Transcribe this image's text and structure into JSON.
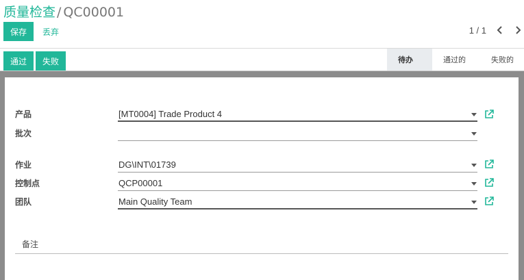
{
  "breadcrumb": {
    "root": "质量检查",
    "separator": "/",
    "current": "QC00001"
  },
  "toolbar": {
    "save_label": "保存",
    "discard_label": "丢弃"
  },
  "pager": {
    "value": "1 / 1"
  },
  "statusbar": {
    "pass_label": "通过",
    "fail_label": "失败",
    "stages": [
      {
        "label": "待办",
        "active": true
      },
      {
        "label": "通过的",
        "active": false
      },
      {
        "label": "失败的",
        "active": false
      }
    ]
  },
  "form": {
    "product": {
      "label": "产品",
      "value": "[MT0004] Trade Product 4"
    },
    "lot": {
      "label": "批次",
      "value": ""
    },
    "operation": {
      "label": "作业",
      "value": "DG\\INT\\01739"
    },
    "control_point": {
      "label": "控制点",
      "value": "QCP00001"
    },
    "team": {
      "label": "团队",
      "value": "Main Quality Team"
    }
  },
  "notebook": {
    "notes_tab": "备注"
  },
  "colors": {
    "accent": "#21b799",
    "sheet_backdrop": "#8c8c8c",
    "active_stage": "#e9ecef"
  },
  "icons": {
    "external": "external-link-icon",
    "prev": "chevron-left-icon",
    "next": "chevron-right-icon"
  }
}
